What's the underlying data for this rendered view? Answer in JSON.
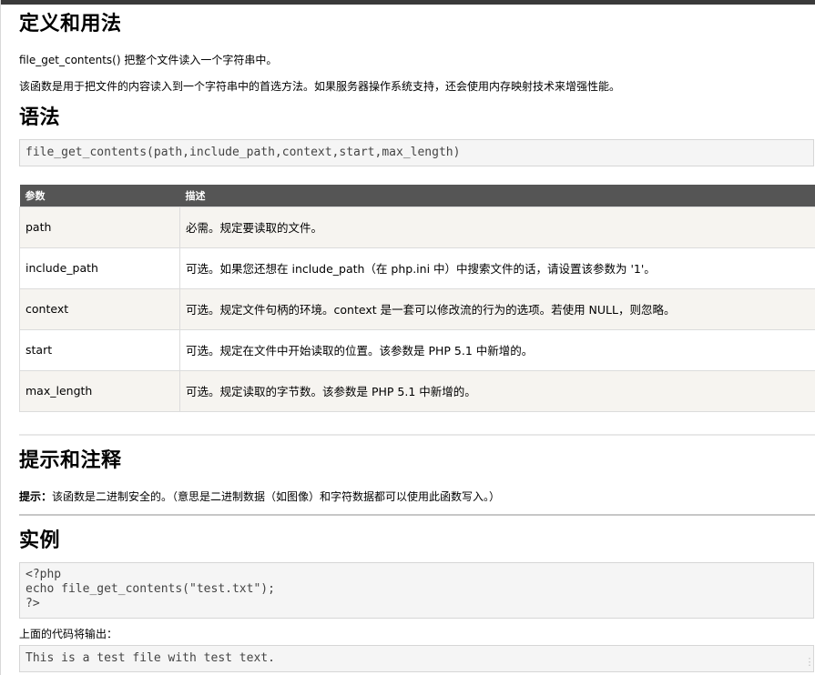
{
  "section_definition": {
    "title": "定义和用法",
    "line1": "file_get_contents() 把整个文件读入一个字符串中。",
    "line2": "该函数是用于把文件的内容读入到一个字符串中的首选方法。如果服务器操作系统支持，还会使用内存映射技术来增强性能。"
  },
  "section_syntax": {
    "title": "语法",
    "code": "file_get_contents(path,include_path,context,start,max_length)"
  },
  "param_table": {
    "headers": [
      "参数",
      "描述"
    ],
    "rows": [
      [
        "path",
        "必需。规定要读取的文件。"
      ],
      [
        "include_path",
        "可选。如果您还想在 include_path（在 php.ini 中）中搜索文件的话，请设置该参数为 '1'。"
      ],
      [
        "context",
        "可选。规定文件句柄的环境。context 是一套可以修改流的行为的选项。若使用 NULL，则忽略。"
      ],
      [
        "start",
        "可选。规定在文件中开始读取的位置。该参数是 PHP 5.1 中新增的。"
      ],
      [
        "max_length",
        "可选。规定读取的字节数。该参数是 PHP 5.1 中新增的。"
      ]
    ]
  },
  "section_tips": {
    "title": "提示和注释",
    "label": "提示：",
    "text": "该函数是二进制安全的。（意思是二进制数据（如图像）和字符数据都可以使用此函数写入。）"
  },
  "section_example": {
    "title": "实例",
    "code_lines": [
      "<?php",
      "echo file_get_contents(\"test.txt\");",
      "?>"
    ],
    "output_label": "上面的代码将输出：",
    "output": "This is a test file with test text."
  }
}
